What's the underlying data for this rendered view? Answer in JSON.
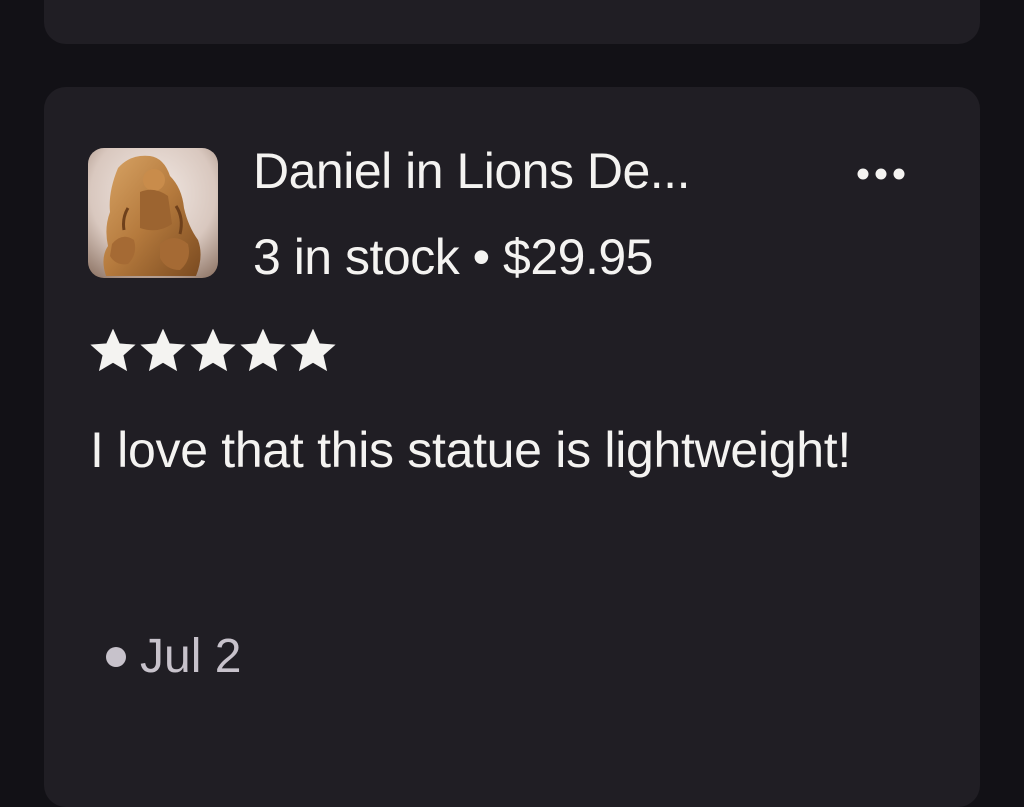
{
  "review_card": {
    "product_title": "Daniel in Lions De...",
    "stock": "3 in stock",
    "separator": "•",
    "price": "$29.95",
    "rating": 5,
    "rating_max": 5,
    "review_text": "I love that this statue is lightweight!",
    "date": "Jul 2",
    "more_icon": "more-horizontal-icon",
    "star_icon": "star-icon"
  },
  "colors": {
    "background": "#121116",
    "card": "#201e24",
    "text": "#f4f3f1",
    "muted": "#c7c2cb"
  }
}
